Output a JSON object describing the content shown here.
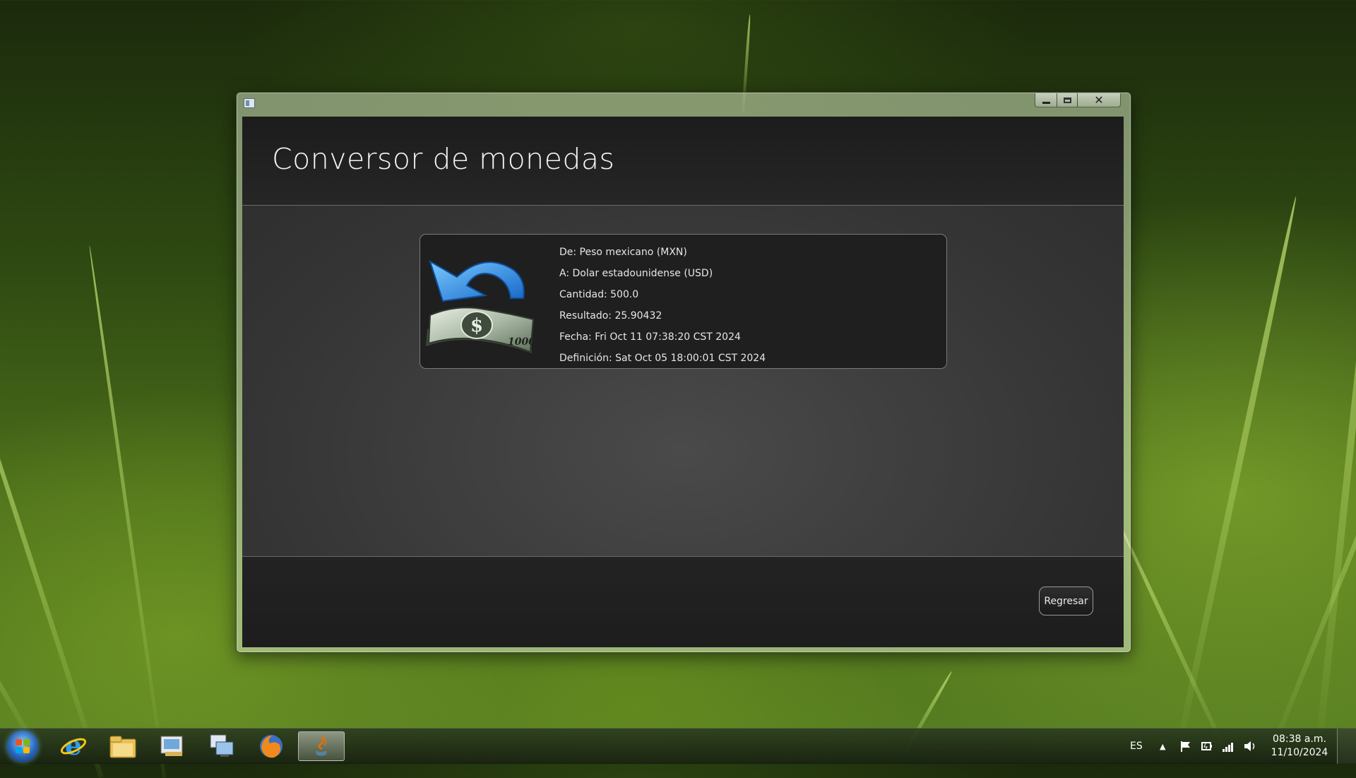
{
  "window": {
    "title": "Conversor de monedas",
    "controls": {
      "minimize": "minimize",
      "maximize": "maximize",
      "close": "close"
    }
  },
  "card": {
    "from": "De: Peso mexicano (MXN)",
    "to": "A: Dolar estadounidense (USD)",
    "amount": "Cantidad: 500.0",
    "result": "Resultado: 25.90432",
    "date": "Fecha: Fri Oct 11 07:38:20 CST 2024",
    "definition": "Definición: Sat Oct 05 18:00:01 CST 2024",
    "bill_value": "1000",
    "icon": "money-exchange-icon"
  },
  "footer": {
    "back_label": "Regresar"
  },
  "taskbar": {
    "apps": [
      "internet-explorer-icon",
      "file-explorer-icon",
      "media-center-icon",
      "remote-desktop-icon",
      "firefox-icon",
      "java-icon"
    ],
    "language": "ES",
    "time": "08:38 a.m.",
    "date": "11/10/2024"
  },
  "colors": {
    "accent": "#2a8be0",
    "window_bg": "#2b2b2b",
    "header_bg": "#1e1e1e"
  }
}
